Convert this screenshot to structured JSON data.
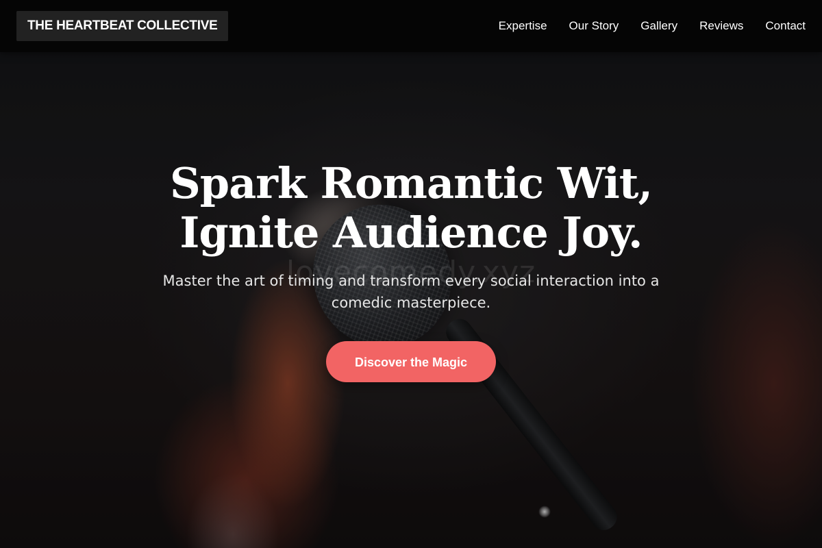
{
  "brand": {
    "name": "THE HEARTBEAT COLLECTIVE"
  },
  "nav": {
    "items": [
      {
        "label": "Expertise"
      },
      {
        "label": "Our Story"
      },
      {
        "label": "Gallery"
      },
      {
        "label": "Reviews"
      },
      {
        "label": "Contact"
      }
    ]
  },
  "hero": {
    "title_line1": "Spark Romantic Wit,",
    "title_line2": "Ignite Audience Joy.",
    "subtitle": "Master the art of timing and transform every social interaction into a comedic masterpiece.",
    "cta_label": "Discover the Magic",
    "watermark": "lovecomedy.xyz",
    "background_image": "microphone-photo"
  },
  "colors": {
    "navbar_bg": "#050505",
    "brand_bg": "#222222",
    "cta_bg": "#f26464",
    "text": "#ffffff"
  }
}
